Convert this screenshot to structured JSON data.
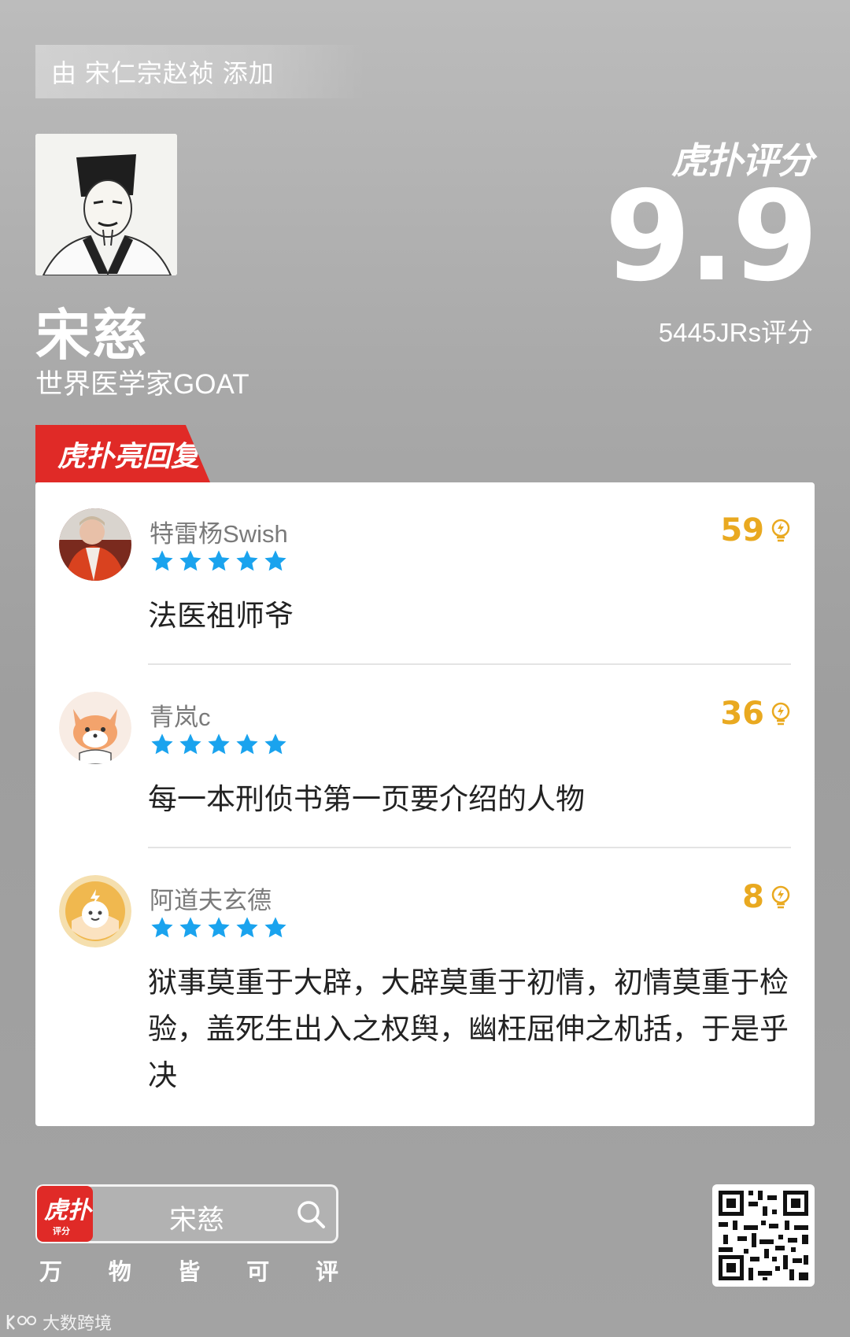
{
  "header": {
    "added_by": "由 宋仁宗赵祯 添加"
  },
  "subject": {
    "name": "宋慈",
    "description": "世界医学家GOAT",
    "portrait_icon": "portrait-image"
  },
  "rating": {
    "brand": "虎扑评分",
    "score": "9.9",
    "count_label": "5445JRs评分"
  },
  "section": {
    "tab_label": "虎扑亮回复"
  },
  "comments": [
    {
      "username": "特雷杨Swish",
      "stars": 5,
      "likes": "59",
      "text": "法医祖师爷"
    },
    {
      "username": "青岚c",
      "stars": 5,
      "likes": "36",
      "text": "每一本刑侦书第一页要介绍的人物"
    },
    {
      "username": "阿道夫玄德",
      "stars": 5,
      "likes": "8",
      "text": "狱事莫重于大辟，大辟莫重于初情，初情莫重于检验，盖死生出入之权舆，幽枉屈伸之机括，于是乎决"
    }
  ],
  "footer": {
    "app_icon_big": "虎扑",
    "app_icon_small": "评分",
    "search_text": "宋慈",
    "slogan": [
      "万",
      "物",
      "皆",
      "可",
      "评"
    ],
    "watermark": "大数跨境"
  },
  "colors": {
    "accent_red": "#e02a27",
    "star_blue": "#1aa3ee",
    "likes_gold": "#e9a920"
  }
}
